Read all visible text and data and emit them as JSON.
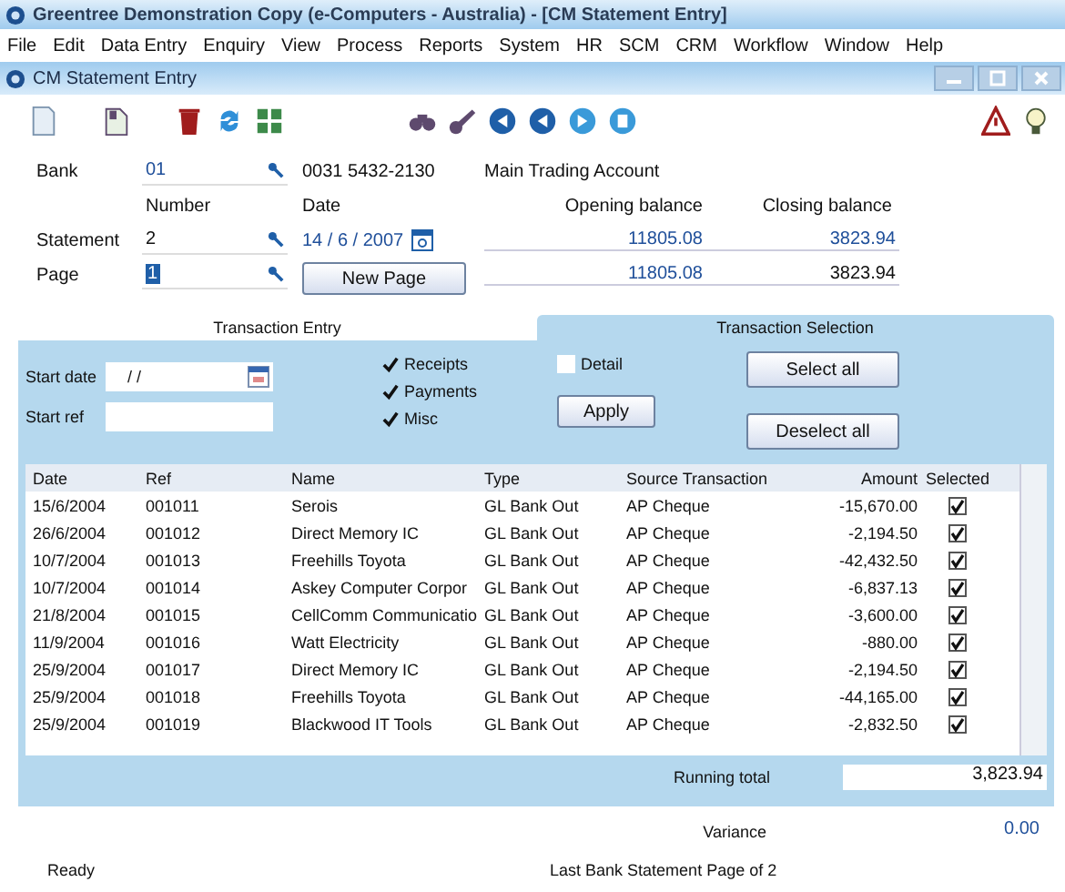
{
  "app_title": "Greentree Demonstration Copy (e-Computers - Australia) - [CM Statement Entry]",
  "menu": [
    "File",
    "Edit",
    "Data Entry",
    "Enquiry",
    "View",
    "Process",
    "Reports",
    "System",
    "HR",
    "SCM",
    "CRM",
    "Workflow",
    "Window",
    "Help"
  ],
  "window": {
    "title": "CM Statement Entry"
  },
  "header": {
    "bank_label": "Bank",
    "bank_code": "01",
    "account_number": "0031 5432-2130",
    "account_name": "Main Trading Account",
    "number_label": "Number",
    "date_label": "Date",
    "opening_label": "Opening balance",
    "closing_label": "Closing balance",
    "statement_label": "Statement",
    "statement_number": "2",
    "date": "14 / 6 / 2007",
    "statement_opening": "11805.08",
    "statement_closing": "3823.94",
    "page_label": "Page",
    "page_number": "1",
    "page_opening": "11805.08",
    "page_closing": "3823.94",
    "new_page_button": "New Page"
  },
  "tabs": [
    {
      "label": "Transaction Entry",
      "selected": false
    },
    {
      "label": "Transaction Selection",
      "selected": true
    }
  ],
  "filters": {
    "start_date_label": "Start date",
    "start_date_value": "/  /",
    "start_ref_label": "Start ref",
    "checkboxes": [
      {
        "label": "Receipts",
        "checked": true
      },
      {
        "label": "Payments",
        "checked": true
      },
      {
        "label": "Misc",
        "checked": true
      },
      {
        "label": "Detail",
        "checked": false
      }
    ],
    "apply_button": "Apply",
    "select_all_button": "Select all",
    "deselect_all_button": "Deselect all"
  },
  "table": {
    "columns": [
      "Date",
      "Ref",
      "Name",
      "Type",
      "Source Transaction",
      "Amount",
      "Selected"
    ],
    "rows": [
      {
        "date": "15/6/2004",
        "ref": "001011",
        "name": "Serois",
        "type": "GL Bank Out",
        "source": "AP Cheque",
        "amount": "-15,670.00",
        "selected": true
      },
      {
        "date": "26/6/2004",
        "ref": "001012",
        "name": "Direct Memory IC",
        "type": "GL Bank Out",
        "source": "AP Cheque",
        "amount": "-2,194.50",
        "selected": true
      },
      {
        "date": "10/7/2004",
        "ref": "001013",
        "name": "Freehills Toyota",
        "type": "GL Bank Out",
        "source": "AP Cheque",
        "amount": "-42,432.50",
        "selected": true
      },
      {
        "date": "10/7/2004",
        "ref": "001014",
        "name": "Askey Computer Corpor",
        "type": "GL Bank Out",
        "source": "AP Cheque",
        "amount": "-6,837.13",
        "selected": true
      },
      {
        "date": "21/8/2004",
        "ref": "001015",
        "name": "CellComm Communicatio",
        "type": "GL Bank Out",
        "source": "AP Cheque",
        "amount": "-3,600.00",
        "selected": true
      },
      {
        "date": "11/9/2004",
        "ref": "001016",
        "name": "Watt Electricity",
        "type": "GL Bank Out",
        "source": "AP Cheque",
        "amount": "-880.00",
        "selected": true
      },
      {
        "date": "25/9/2004",
        "ref": "001017",
        "name": "Direct Memory IC",
        "type": "GL Bank Out",
        "source": "AP Cheque",
        "amount": "-2,194.50",
        "selected": true
      },
      {
        "date": "25/9/2004",
        "ref": "001018",
        "name": "Freehills Toyota",
        "type": "GL Bank Out",
        "source": "AP Cheque",
        "amount": "-44,165.00",
        "selected": true
      },
      {
        "date": "25/9/2004",
        "ref": "001019",
        "name": "Blackwood IT Tools",
        "type": "GL Bank Out",
        "source": "AP Cheque",
        "amount": "-2,832.50",
        "selected": true
      }
    ]
  },
  "running_total_label": "Running total",
  "running_total": "3,823.94",
  "variance_label": "Variance",
  "variance": "0.00",
  "status_bar": {
    "state": "Ready",
    "message": "Last Bank Statement Page of 2"
  }
}
